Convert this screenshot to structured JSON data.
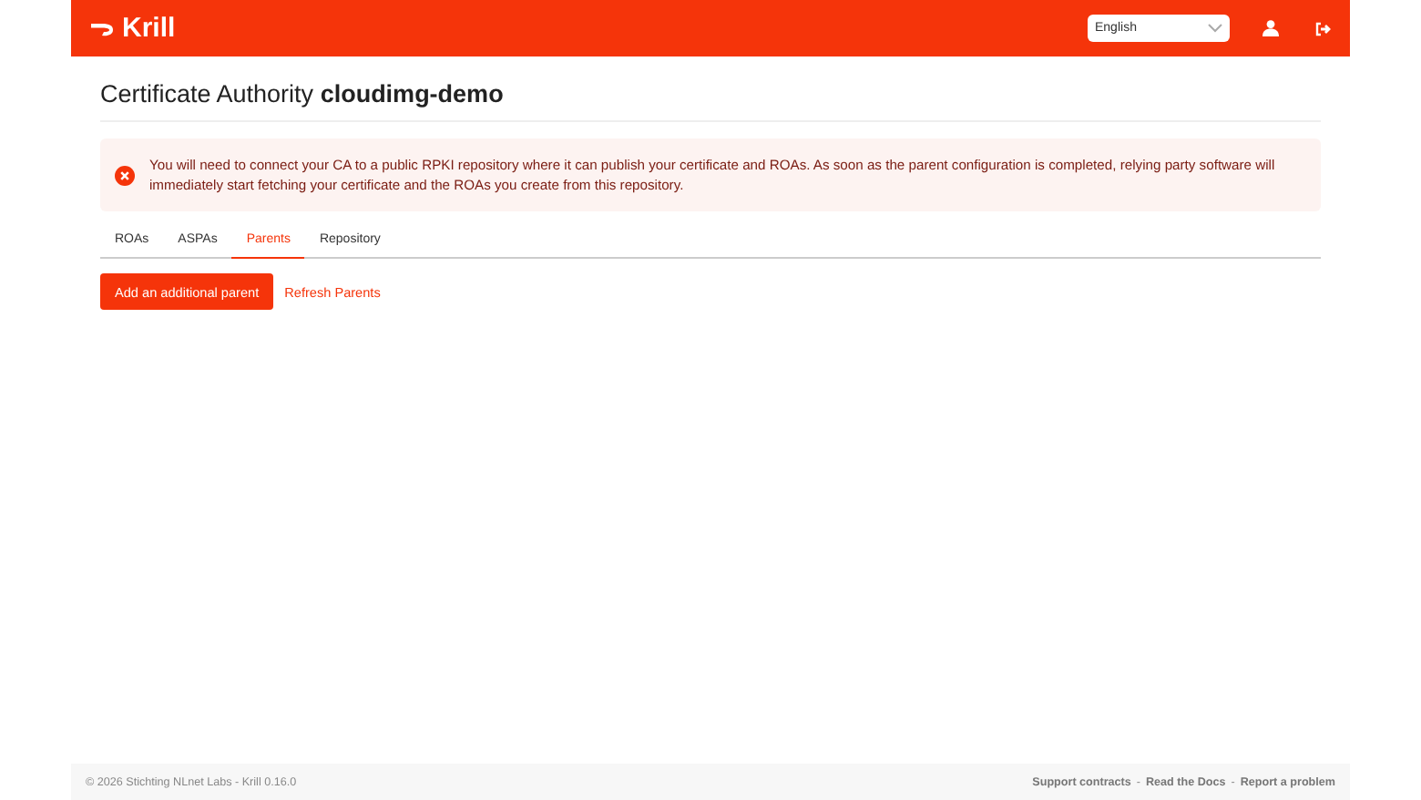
{
  "header": {
    "logo": "Krill",
    "language": {
      "value": "English"
    }
  },
  "page": {
    "title_prefix": "Certificate Authority",
    "ca_name": "cloudimg-demo"
  },
  "alert": {
    "text": "You will need to connect your CA to a public RPKI repository where it can publish your certificate and ROAs. As soon as the parent configuration is completed, relying party software will immediately start fetching your certificate and the ROAs you create from this repository."
  },
  "tabs": [
    {
      "label": "ROAs",
      "selected": false
    },
    {
      "label": "ASPAs",
      "selected": false
    },
    {
      "label": "Parents",
      "selected": true
    },
    {
      "label": "Repository",
      "selected": false
    }
  ],
  "actions": {
    "primary": "Add an additional parent",
    "secondary": "Refresh Parents"
  },
  "footer": {
    "copyright": "© 2026 Stichting NLnet Labs - Krill 0.16.0",
    "separator": "-",
    "links": [
      "Support contracts",
      "Read the Docs",
      "Report a problem"
    ]
  }
}
